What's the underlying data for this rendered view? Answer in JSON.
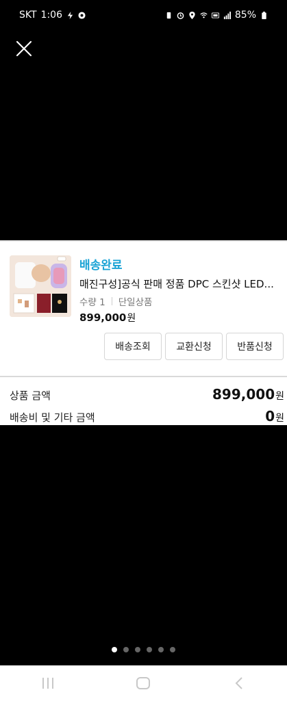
{
  "status_bar": {
    "carrier": "SKT",
    "time": "1:06",
    "battery": "85%"
  },
  "order": {
    "status": "배송완료",
    "product_title": "매진구성]공식 판매 정품 DPC 스킨샷 LED...",
    "quantity": "수량 1",
    "option": "단일상품",
    "price": "899,000",
    "price_unit": "원",
    "status_color": "#1aa3d5"
  },
  "buttons": {
    "tracking": "배송조회",
    "exchange": "교환신청",
    "return": "반품신청"
  },
  "summary": {
    "product_amount_label": "상품 금액",
    "product_amount_value": "899,000",
    "product_amount_unit": "원",
    "shipping_label": "배송비 및 기타 금액",
    "shipping_value": "0",
    "shipping_unit": "원"
  },
  "pagination": {
    "total": 6,
    "active": 1
  }
}
